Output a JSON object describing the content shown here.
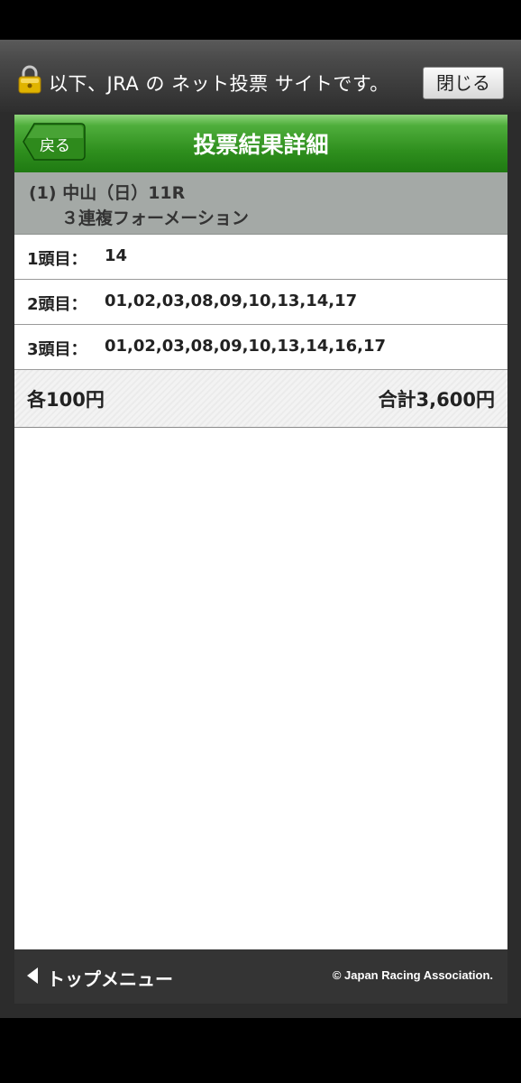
{
  "banner": {
    "lock_icon": "lock-icon",
    "notice": "以下、JRA の ネット投票 サイトです。",
    "close_label": "閉じる"
  },
  "header": {
    "back_label": "戻る",
    "title": "投票結果詳細"
  },
  "race": {
    "name": "(1) 中山（日）11R",
    "bet_type": "３連複フォーメーション"
  },
  "picks": [
    {
      "label": "1頭目：",
      "horses": "14"
    },
    {
      "label": "2頭目：",
      "horses": "01,02,03,08,09,10,13,14,17"
    },
    {
      "label": "3頭目：",
      "horses": "01,02,03,08,09,10,13,14,16,17"
    }
  ],
  "summary": {
    "each": "各100円",
    "total": "合計3,600円"
  },
  "footer": {
    "menu_label": "トップメニュー",
    "copyright": "© Japan Racing Association."
  },
  "colors": {
    "header_green": "#2f8f1e",
    "race_panel": "#a4a9a6",
    "footer": "#343434"
  }
}
